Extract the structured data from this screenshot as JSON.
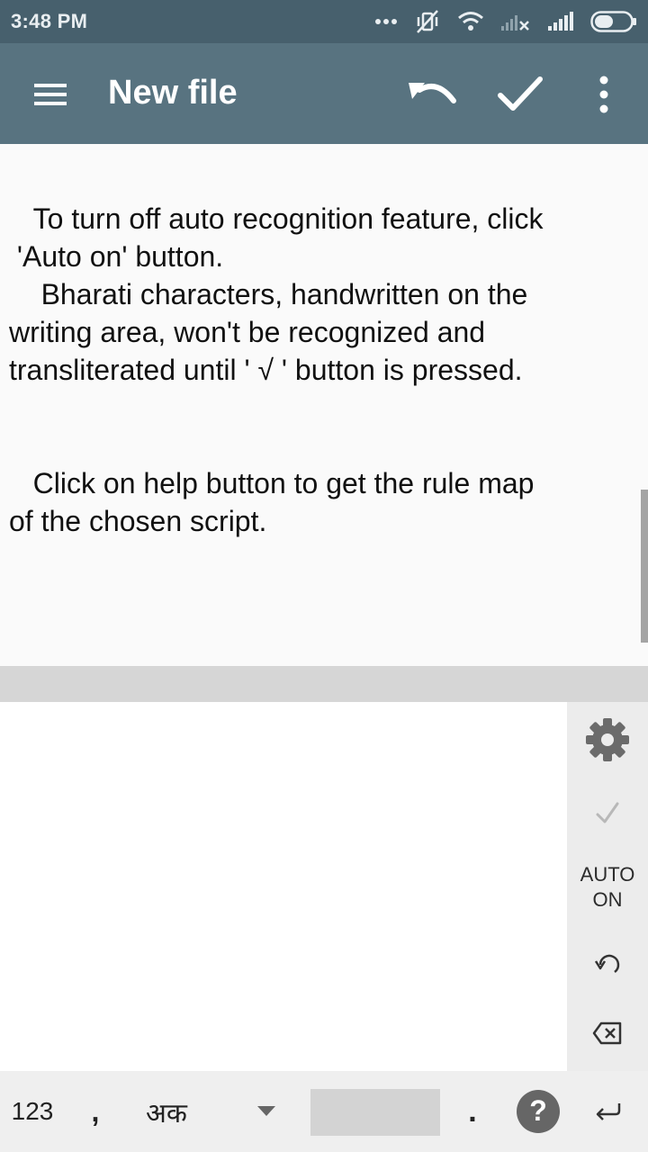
{
  "status_bar": {
    "time": "3:48 PM",
    "icons": [
      "more-dots-icon",
      "vibrate-off-icon",
      "wifi-icon",
      "no-signal-icon",
      "signal-icon",
      "battery-icon"
    ]
  },
  "app_bar": {
    "title": "New file",
    "icons": [
      "hamburger-menu-icon",
      "undo-icon",
      "check-icon",
      "overflow-menu-icon"
    ]
  },
  "content": {
    "paragraph_1": "   To turn off auto recognition feature, click\n 'Auto on' button.\n    Bharati characters, handwritten on the\nwriting area, won't be recognized and\ntransliterated until ' √ ' button is pressed.",
    "paragraph_2": "   Click on help button to get the rule map\nof the chosen script."
  },
  "tools": {
    "auto_line1": "AUTO",
    "auto_line2": "ON",
    "icons": [
      "settings-gear-icon",
      "recognize-check-icon",
      "rotate-undo-icon",
      "backspace-icon"
    ]
  },
  "keyboard": {
    "numbers_label": "123",
    "comma_label": ",",
    "script_label": "अक",
    "period_label": ".",
    "help_label": "?",
    "icons": [
      "dropdown-arrow-icon",
      "help-icon",
      "enter-icon"
    ]
  },
  "colors": {
    "status_bar": "#47606d",
    "app_bar": "#587380",
    "content_bg": "#fafafa",
    "divider": "#d6d6d6",
    "tool_column": "#ececec",
    "keyboard_row": "#efefef",
    "help_circle": "#666666"
  }
}
